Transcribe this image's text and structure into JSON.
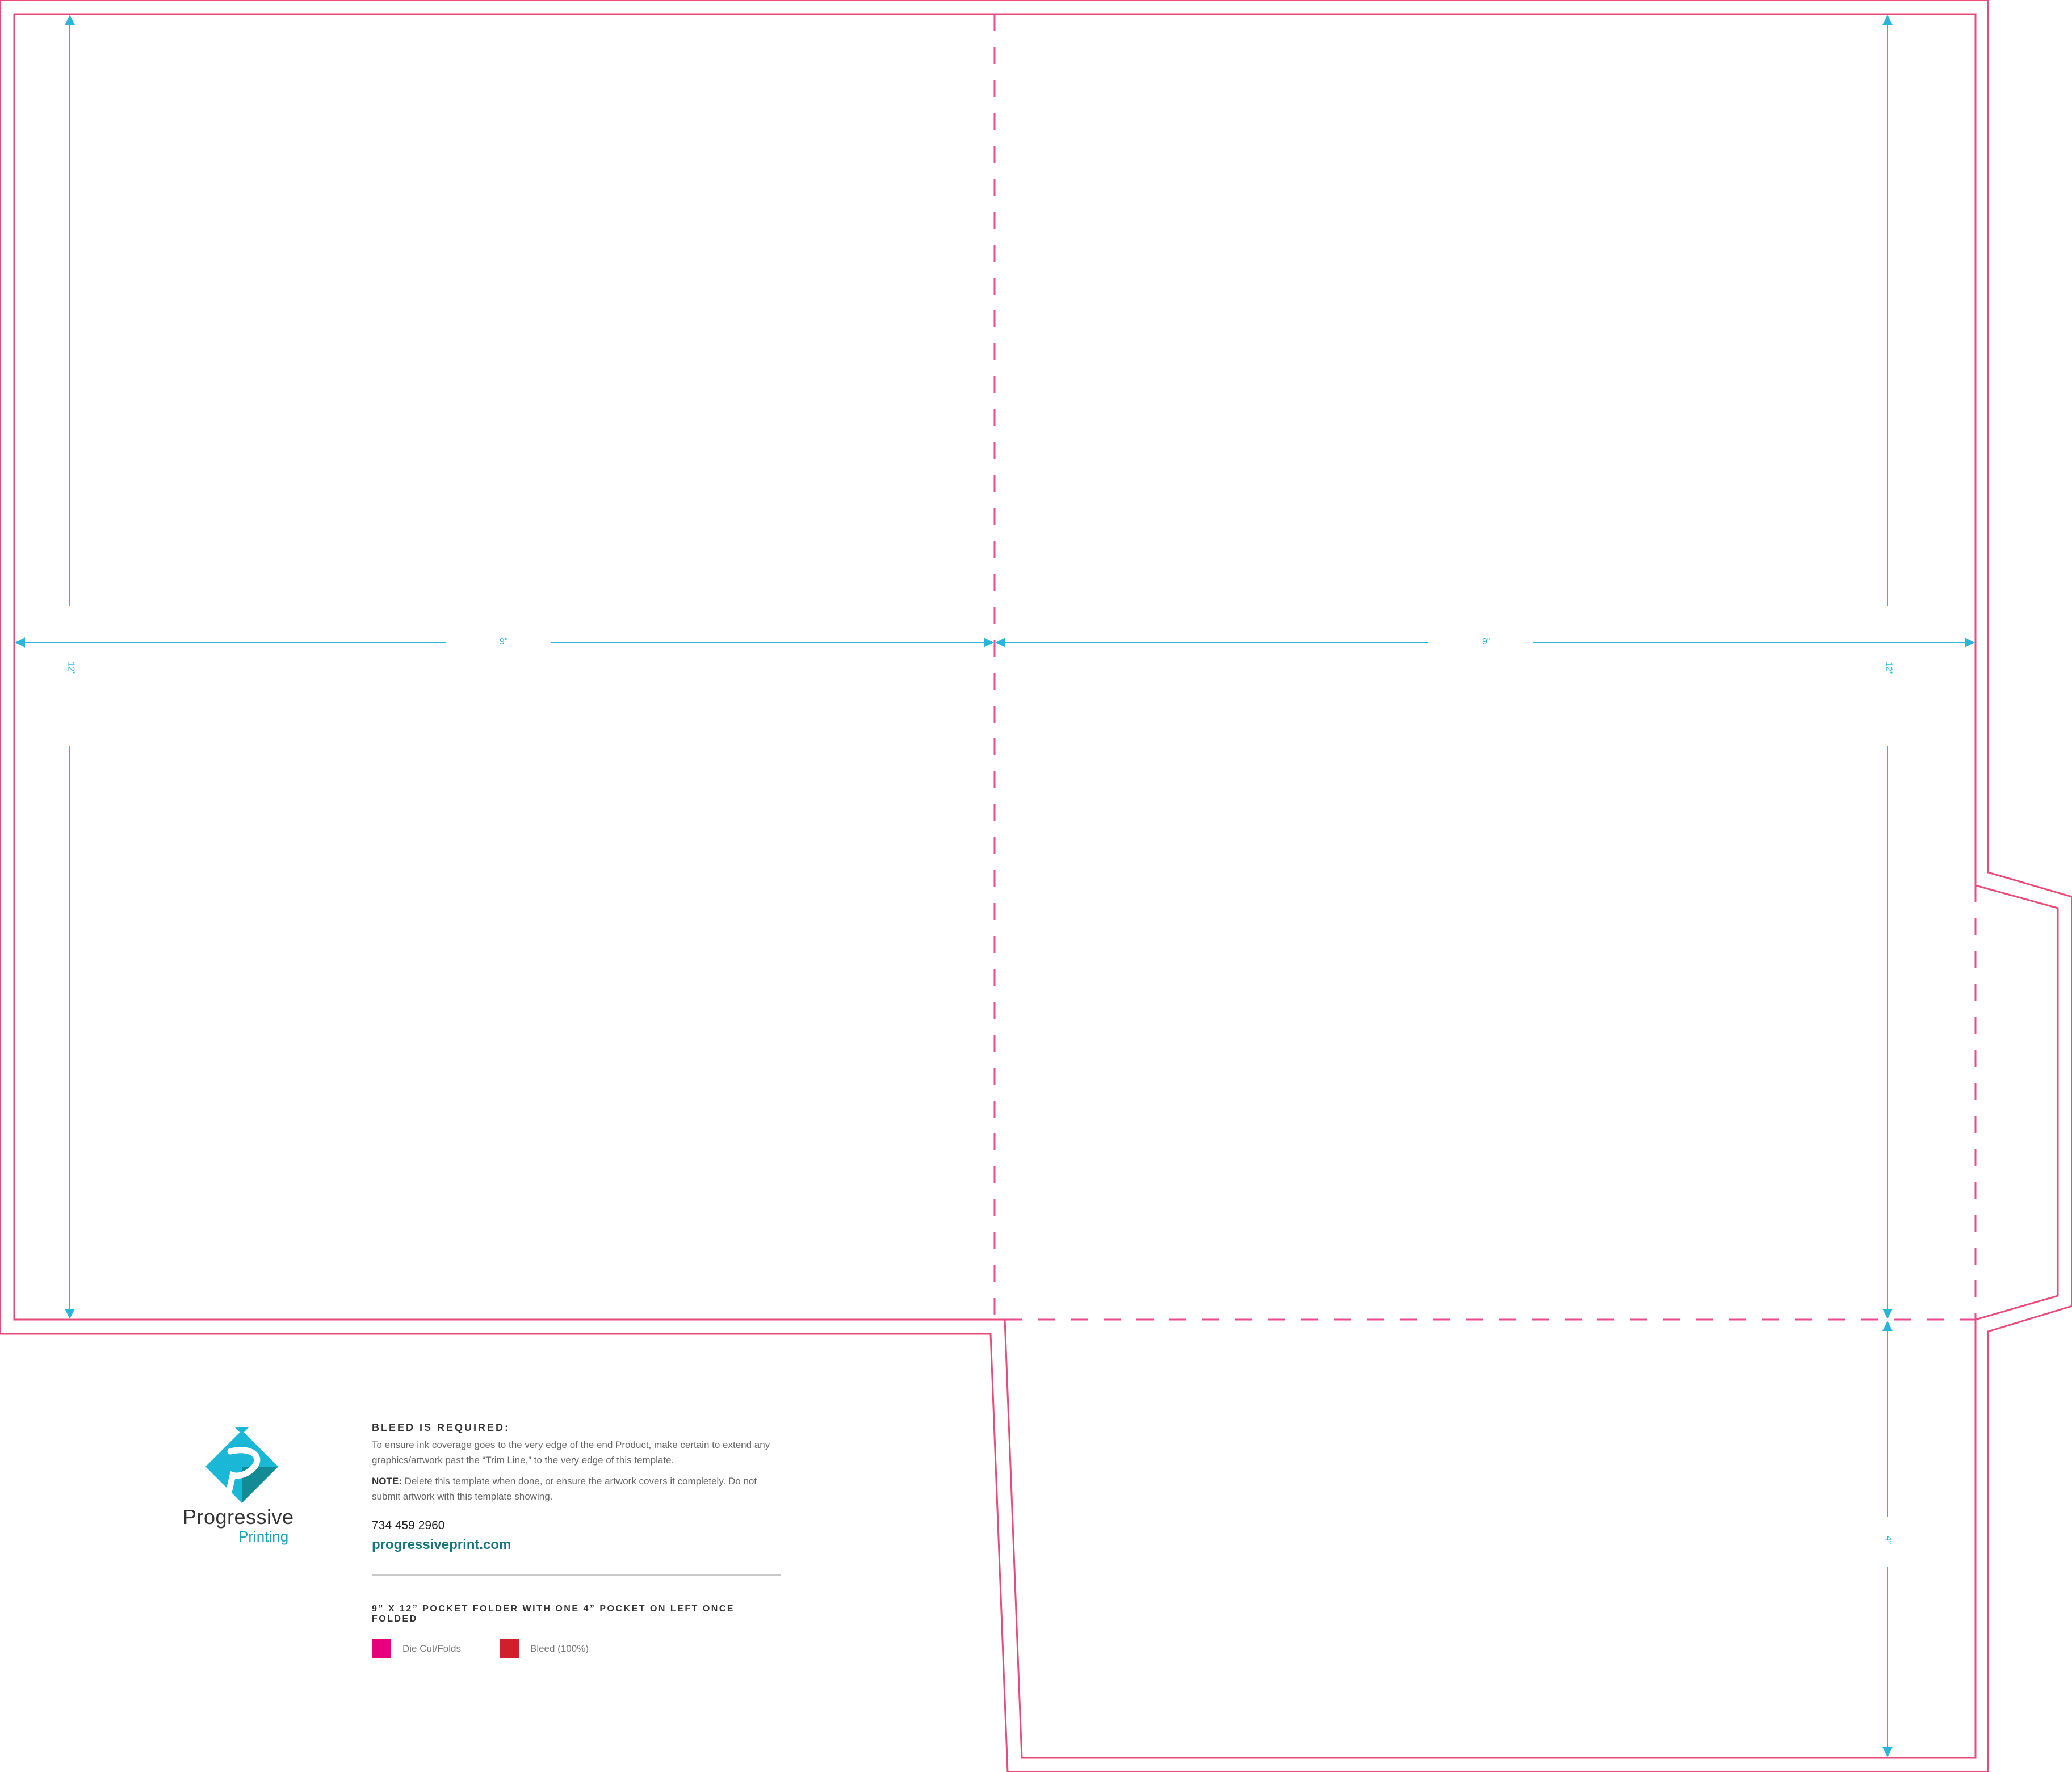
{
  "dimensions": {
    "panel_width": "9\"",
    "panel_height": "12\"",
    "pocket_height": "4\""
  },
  "logo": {
    "wordmark": "Progressive",
    "subline": "Printing"
  },
  "info": {
    "bleed_heading": "BLEED IS REQUIRED:",
    "bleed_text": "To ensure ink coverage goes to the very edge of the end Product, make certain to extend any graphics/artwork past the “Trim Line,” to the very edge of this template.",
    "note_label": "NOTE:",
    "note_text": " Delete this template when done, or ensure the artwork covers it completely. Do not submit artwork with this template showing.",
    "phone": "734 459 2960",
    "website": "progressiveprint.com",
    "spec_title": "9” X 12” POCKET FOLDER WITH ONE 4” POCKET ON LEFT ONCE FOLDED"
  },
  "legend": [
    {
      "label": "Die Cut/Folds",
      "color": "#e6007e"
    },
    {
      "label": "Bleed (100%)",
      "color": "#d0202c"
    }
  ],
  "colors": {
    "die_cut": "#e6007e",
    "bleed": "#d0202c",
    "dimension": "#29b6d8",
    "logo_light": "#1ab8d6",
    "logo_dark": "#138a94"
  }
}
